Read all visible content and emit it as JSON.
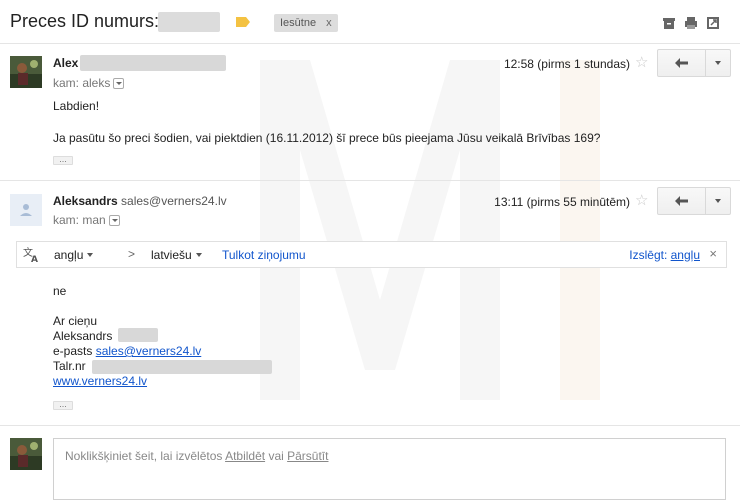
{
  "header": {
    "subject": "Preces ID numurs:",
    "inbox_tag": "Iesūtne",
    "inbox_tag_close": "x",
    "label_color": "#f4c242",
    "icons": [
      "archive-icon",
      "print-icon",
      "new-window-icon"
    ]
  },
  "messages": [
    {
      "sender": "Alex",
      "to_prefix": "kam: aleks",
      "time": "12:58 (pirms 1 stundas)",
      "body": [
        "Labdien!",
        "Ja pasūtu šo preci šodien, vai piektdien (16.11.2012) šī prece būs pieejama Jūsu veikalā Brīvības 169?"
      ],
      "ellipsis": "..."
    },
    {
      "sender": "Aleksandrs",
      "sender_email": "sales@verners24.lv",
      "to_prefix": "kam: man",
      "time": "13:11 (pirms 55 minūtēm)",
      "translate_bar": {
        "from_lang": "angļu",
        "arrow": ">",
        "to_lang": "latviešu",
        "translate_link": "Tulkot ziņojumu",
        "disable_prefix": "Izslēgt:",
        "disable_lang": "angļu",
        "close": "×"
      },
      "body_first": "ne",
      "signature": {
        "greeting": "Ar cieņu",
        "name": "Aleksandrs",
        "email_label": "e-pasts",
        "email": "sales@verners24.lv",
        "phone_label": "Talr.nr",
        "website": "www.verners24.lv"
      },
      "ellipsis": "..."
    }
  ],
  "reply": {
    "placeholder_start": "Noklikšķiniet šeit, lai izvēlētos",
    "reply_link": "Atbildēt",
    "or": "vai",
    "forward_link": "Pārsūtīt"
  }
}
